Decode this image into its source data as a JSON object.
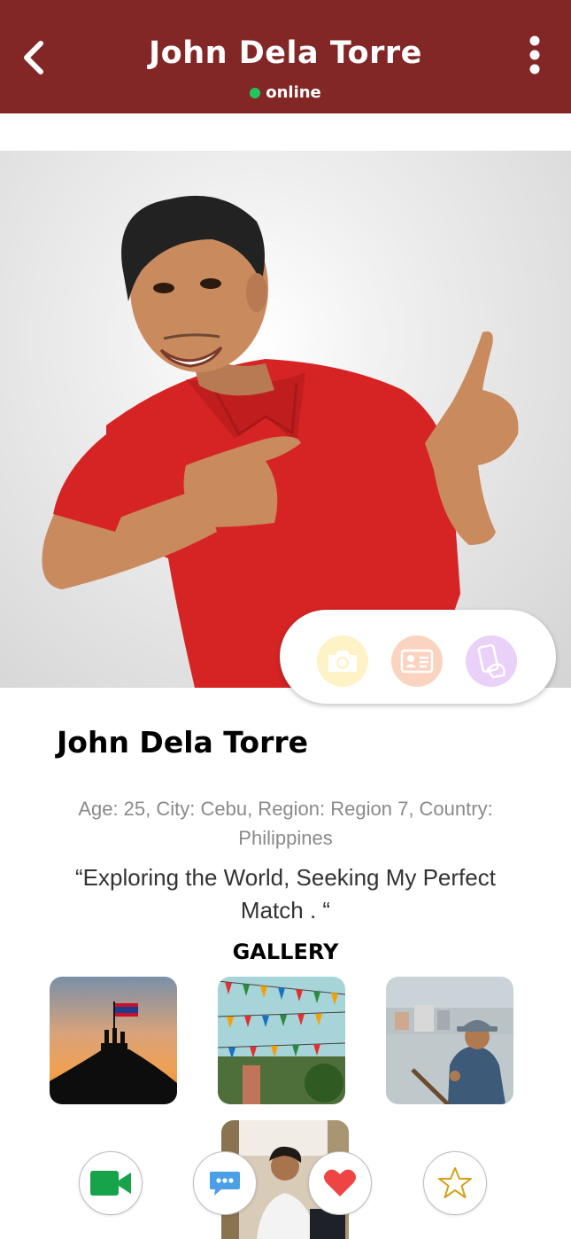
{
  "header": {
    "title": "John Dela Torre",
    "status": "online",
    "back_icon": "chevron-left-icon",
    "menu_icon": "more-vertical-icon",
    "color": "#822626"
  },
  "verification": {
    "items": [
      {
        "name": "photo-verified",
        "icon": "camera-icon",
        "color": "#fef3c7"
      },
      {
        "name": "id-verified",
        "icon": "id-card-icon",
        "color": "#fad4c0"
      },
      {
        "name": "phone-verified",
        "icon": "phone-hand-icon",
        "color": "#ead1f7"
      }
    ]
  },
  "profile": {
    "name": "John Dela Torre",
    "details_line1": "Age: 25, City:  Cebu, Region: Region 7, Country:",
    "details_line2": "Philippines",
    "bio_line1": "“Exploring the World, Seeking My Perfect",
    "bio_line2": "Match . “"
  },
  "gallery": {
    "title": "GALLERY",
    "items": [
      {
        "name": "gallery-photo-sunset-flag"
      },
      {
        "name": "gallery-photo-festival-flags"
      },
      {
        "name": "gallery-photo-boat-rower"
      },
      {
        "name": "gallery-photo-portrait"
      }
    ]
  },
  "actions": [
    {
      "name": "video-call-button",
      "icon": "video-camera-icon",
      "color": "#16a34a"
    },
    {
      "name": "chat-button",
      "icon": "chat-bubble-icon",
      "color": "#4a9fe6"
    },
    {
      "name": "like-button",
      "icon": "heart-icon",
      "color": "#ef4444"
    },
    {
      "name": "favorite-button",
      "icon": "star-icon",
      "color": "#d4a017"
    }
  ]
}
